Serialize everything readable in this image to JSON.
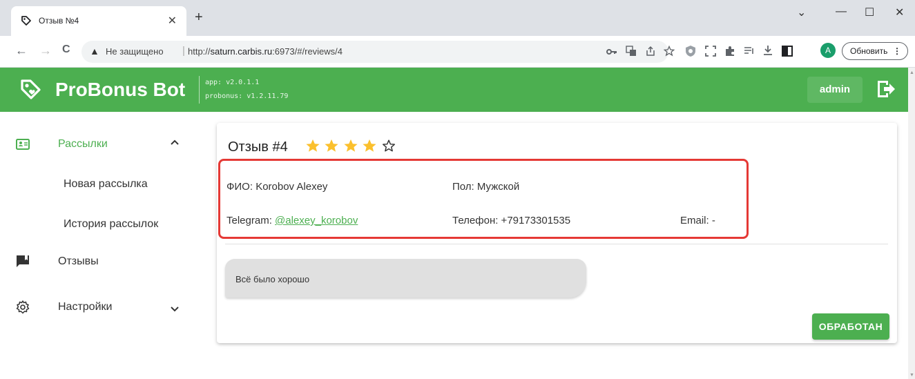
{
  "browser": {
    "tab_title": "Отзыв №4",
    "tab_close": "✕",
    "new_tab": "+",
    "warn_icon": "▲",
    "insecure_label": "Не защищено",
    "separator": "|",
    "url_prefix": "http://",
    "url_host": "saturn.carbis.ru",
    "url_path": ":6973/#/reviews/4",
    "update_button": "Обновить",
    "avatar_letter": "A",
    "back": "←",
    "forward": "→",
    "reload": "C",
    "win_minimize": "—",
    "win_maximize": "☐",
    "win_close": "✕",
    "win_menu": "⌄"
  },
  "header": {
    "brand": "ProBonus Bot",
    "app_version": "app: v2.0.1.1",
    "probonus_version": "probonus: v1.2.11.79",
    "admin_label": "admin"
  },
  "sidebar": {
    "items": [
      {
        "label": "Рассылки",
        "icon": "contact-card-icon",
        "expanded": true
      },
      {
        "label": "Отзывы",
        "icon": "comment-icon"
      },
      {
        "label": "Настройки",
        "icon": "gear-icon",
        "expanded": false
      }
    ],
    "subitems": [
      {
        "label": "Новая рассылка"
      },
      {
        "label": "История рассылок"
      }
    ]
  },
  "review": {
    "title": "Отзыв #4",
    "rating": 4,
    "rating_max": 5,
    "fio": "ФИО: Korobov Alexey",
    "gender": "Пол: Мужской",
    "telegram_label": "Telegram: ",
    "telegram_handle": "@alexey_korobov",
    "phone": "Телефон: +79173301535",
    "email": "Email: -",
    "message": "Всё было хорошо",
    "processed_button": "ОБРАБОТАН"
  },
  "colors": {
    "accent": "#4caf50",
    "star": "#fbc02d",
    "highlight": "#e53935"
  }
}
